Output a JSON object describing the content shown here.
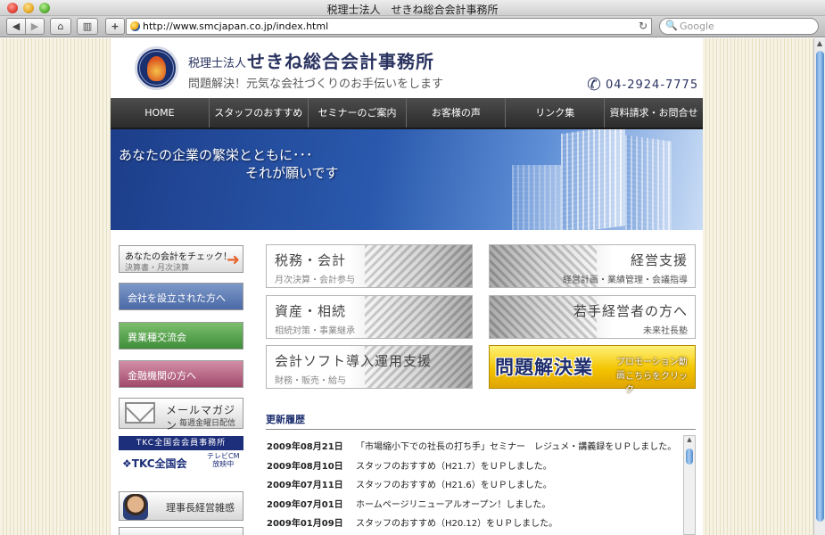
{
  "window": {
    "title": "税理士法人　せきね総合会計事務所"
  },
  "browser": {
    "back_label": "◀",
    "forward_label": "▶",
    "home_label": "⌂",
    "bookmark_label": "▥",
    "add_label": "+",
    "url": "http://www.smcjapan.co.jp/index.html",
    "reload_label": "↻",
    "search_placeholder": "Google",
    "search_icon": "🔍"
  },
  "site": {
    "brand_prefix": "税理士法人",
    "brand_name": "せきね総合会計事務所",
    "tagline": "問題解決！元気な会社づくりのお手伝いをします",
    "phone_icon": "✆",
    "phone": "04-2924-7775",
    "nav": [
      {
        "label": "HOME"
      },
      {
        "label": "スタッフのおすすめ"
      },
      {
        "label": "セミナーのご案内"
      },
      {
        "label": "お客様の声"
      },
      {
        "label": "リンク集"
      },
      {
        "label": "資料請求・お問合せ"
      }
    ],
    "hero": {
      "line1": "あなたの企業の繁栄とともに･･･",
      "line2": "それが願いです"
    },
    "sidebar": {
      "check": {
        "title": "あなたの会計をチェック！",
        "sub": "決算書・月次決算",
        "arrow": "➜"
      },
      "company": "会社を設立された方へ",
      "exchange": "異業種交流会",
      "finance": "金融機関の方へ",
      "mail": {
        "title": "メールマガジン",
        "sub": "毎週金曜日配信"
      },
      "tkc": {
        "header": "TKC全国会会員事務所",
        "logo": "❖TKC全国会",
        "tv1": "テレビCM",
        "tv2": "放映中"
      },
      "chairman": "理事長経営雑感"
    },
    "panels": [
      {
        "title": "税務・会計",
        "sub": "月次決算・会計参与"
      },
      {
        "title": "経営支援",
        "sub": "経営計画・業績管理・会議指導"
      },
      {
        "title": "資産・相続",
        "sub": "相続対策・事業継承"
      },
      {
        "title": "若手経営者の方へ",
        "sub": "未来社長塾"
      },
      {
        "title": "会計ソフト導入運用支援",
        "sub": "財務・販売・給与"
      }
    ],
    "promo": {
      "title": "問題解決業",
      "sub1": "プロモーション動画",
      "sub2": "こちらをクリック"
    },
    "news": {
      "title": "更新履歴",
      "items": [
        {
          "date": "2009年08月21日",
          "text": "「市場縮小下での社長の打ち手」セミナー　レジュメ・講義録をＵＰしました。"
        },
        {
          "date": "2009年08月10日",
          "text": "スタッフのおすすめ（H21.7）をＵＰしました。"
        },
        {
          "date": "2009年07月11日",
          "text": "スタッフのおすすめ（H21.6）をＵＰしました。"
        },
        {
          "date": "2009年07月01日",
          "text": "ホームページリニューアルオープン！しました。"
        },
        {
          "date": "2009年01月09日",
          "text": "スタッフのおすすめ（H20.12）をＵＰしました。"
        }
      ]
    }
  }
}
